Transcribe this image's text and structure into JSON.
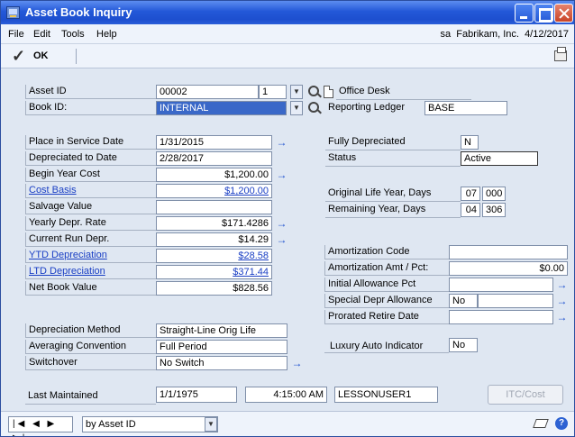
{
  "window": {
    "title": "Asset Book Inquiry"
  },
  "menu": {
    "items": [
      "File",
      "Edit",
      "Tools",
      "Help"
    ],
    "user": "sa",
    "company": "Fabrikam, Inc.",
    "date": "4/12/2017"
  },
  "toolbar": {
    "ok_label": "OK"
  },
  "header": {
    "asset_id_label": "Asset ID",
    "asset_id": "00002",
    "asset_suffix": "1",
    "asset_desc": "Office Desk",
    "book_id_label": "Book ID:",
    "book_id": "INTERNAL",
    "reporting_ledger_label": "Reporting Ledger",
    "reporting_ledger": "BASE"
  },
  "left": {
    "place_in_service_label": "Place in Service Date",
    "place_in_service": "1/31/2015",
    "depreciated_to_label": "Depreciated to Date",
    "depreciated_to": "2/28/2017",
    "begin_year_cost_label": "Begin Year Cost",
    "begin_year_cost": "$1,200.00",
    "cost_basis_label": "Cost Basis",
    "cost_basis": "$1,200.00",
    "salvage_value_label": "Salvage Value",
    "salvage_value": "",
    "yearly_rate_label": "Yearly Depr. Rate",
    "yearly_rate": "$171.4286",
    "current_run_label": "Current Run Depr.",
    "current_run": "$14.29",
    "ytd_label": "YTD Depreciation",
    "ytd": "$28.58",
    "ltd_label": "LTD Depreciation",
    "ltd": "$371.44",
    "net_book_label": "Net Book Value",
    "net_book": "$828.56"
  },
  "right": {
    "fully_depreciated_label": "Fully Depreciated",
    "fully_depreciated": "N",
    "status_label": "Status",
    "status": "Active",
    "original_life_label": "Original Life Year, Days",
    "original_life_years": "07",
    "original_life_days": "000",
    "remaining_label": "Remaining Year, Days",
    "remaining_years": "04",
    "remaining_days": "306",
    "amort_code_label": "Amortization Code",
    "amort_code": "",
    "amort_amt_label": "Amortization Amt / Pct:",
    "amort_amt": "$0.00",
    "initial_allowance_label": "Initial Allowance Pct",
    "initial_allowance": "",
    "special_allowance_label": "Special Depr Allowance",
    "special_allowance": "No",
    "prorated_label": "Prorated Retire Date",
    "prorated": "",
    "luxury_label": "Luxury Auto Indicator",
    "luxury": "No"
  },
  "method": {
    "depr_method_label": "Depreciation Method",
    "depr_method": "Straight-Line Orig Life",
    "averaging_label": "Averaging Convention",
    "averaging": "Full Period",
    "switchover_label": "Switchover",
    "switchover": "No Switch"
  },
  "maintained": {
    "label": "Last Maintained",
    "date": "1/1/1975",
    "time": "4:15:00 AM",
    "user": "LESSONUSER1"
  },
  "buttons": {
    "itc": "ITC/Cost"
  },
  "footer": {
    "nav": "|◀ ◀ ▶ ▶|",
    "sort": "by Asset ID"
  }
}
